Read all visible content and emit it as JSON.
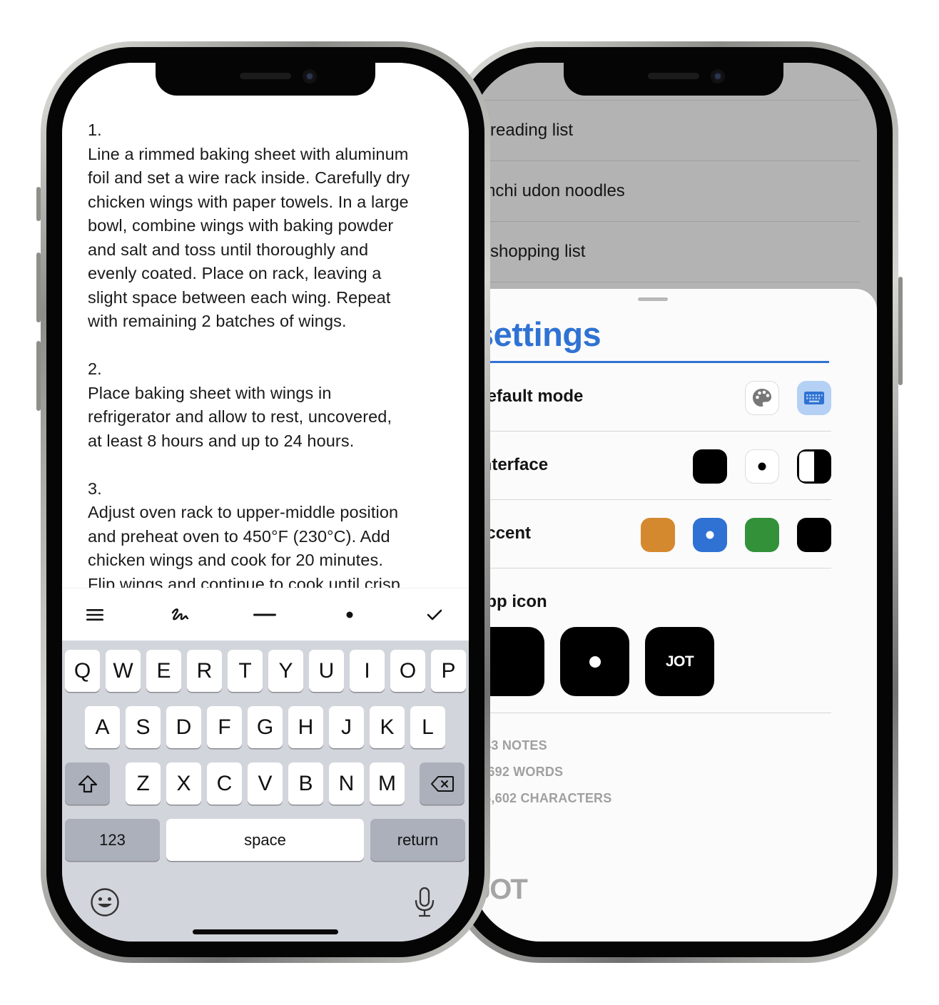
{
  "editor": {
    "steps": [
      {
        "number": "1.",
        "text": "Line a rimmed baking sheet with aluminum\nfoil and set a wire rack inside. Carefully dry\nchicken wings with paper towels. In a large\nbowl, combine wings with baking powder\nand salt and toss until thoroughly and\nevenly coated. Place on rack, leaving a\nslight space between each wing. Repeat\nwith remaining 2 batches of wings."
      },
      {
        "number": "2.",
        "text": "Place baking sheet with wings in\nrefrigerator and allow to rest, uncovered,\nat least 8 hours and up to 24 hours."
      },
      {
        "number": "3.",
        "text": "Adjust oven rack to upper-middle position\nand preheat oven to 450°F (230°C). Add\nchicken wings and cook for 20 minutes.\nFlip wings and continue to cook until crisp"
      }
    ]
  },
  "toolbar": {
    "icons": [
      "list-icon",
      "handwriting-icon",
      "divider-icon",
      "bullet-icon",
      "checkmark-icon"
    ]
  },
  "keyboard": {
    "row1": [
      "Q",
      "W",
      "E",
      "R",
      "T",
      "Y",
      "U",
      "I",
      "O",
      "P"
    ],
    "row2": [
      "A",
      "S",
      "D",
      "F",
      "G",
      "H",
      "J",
      "K",
      "L"
    ],
    "row3": [
      "Z",
      "X",
      "C",
      "V",
      "B",
      "N",
      "M"
    ],
    "numbers_label": "123",
    "space_label": "space",
    "return_label": "return"
  },
  "notes_list": [
    {
      "emoji": "📚",
      "title": "reading list"
    },
    {
      "emoji": "",
      "title": "kimchi udon noodles"
    },
    {
      "emoji": "🛒",
      "title": "shopping list"
    }
  ],
  "settings": {
    "title": "settings",
    "default_mode": {
      "label": "default mode",
      "options": [
        "palette-icon",
        "keyboard-icon"
      ],
      "selected": "keyboard-icon"
    },
    "interface": {
      "label": "interface",
      "options": [
        "dark",
        "light",
        "auto"
      ],
      "selected": "light"
    },
    "accent": {
      "label": "accent",
      "colors": [
        "#d5892f",
        "#2f72d3",
        "#33913a",
        "#000000"
      ],
      "selected": "#2f72d3"
    },
    "app_icon": {
      "label": "app icon",
      "options": [
        "blank",
        "dot",
        "wordmark"
      ],
      "wordmark": "JOT"
    },
    "stats": {
      "notes": "143 NOTES",
      "words": "8,692 WORDS",
      "characters": "56,602 CHARACTERS"
    },
    "brand": "JOT"
  },
  "colors": {
    "accent": "#2f72d3",
    "sheet_bg": "#fbfbfb",
    "list_bg": "#b3b3b3",
    "keyboard_bg": "#d2d5db"
  }
}
